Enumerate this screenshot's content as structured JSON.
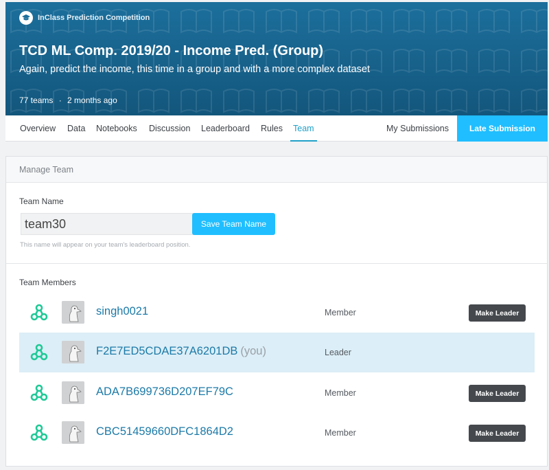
{
  "header": {
    "competition_type": "InClass Prediction Competition",
    "title": "TCD ML Comp. 2019/20 - Income Pred. (Group)",
    "subtitle": "Again, predict the income, this time in a group and with a more complex dataset",
    "teams": "77 teams",
    "separator": "·",
    "age": "2 months ago",
    "color": "#1c6f9c"
  },
  "tabs": [
    {
      "label": "Overview"
    },
    {
      "label": "Data"
    },
    {
      "label": "Notebooks"
    },
    {
      "label": "Discussion"
    },
    {
      "label": "Leaderboard"
    },
    {
      "label": "Rules"
    },
    {
      "label": "Team",
      "active": true
    },
    {
      "label": "My Submissions"
    }
  ],
  "late_submission_label": "Late Submission",
  "accent_color": "#20beff",
  "manage_team": {
    "heading": "Manage Team",
    "name_label": "Team Name",
    "name_value": "team30",
    "save_label": "Save Team Name",
    "hint": "This name will appear on your team's leaderboard position."
  },
  "members": {
    "heading": "Team Members",
    "make_leader_label": "Make Leader",
    "list": [
      {
        "name": "singh0021",
        "you": "",
        "role": "Member",
        "can_make_leader": true
      },
      {
        "name": "F2E7ED5CDAE37A6201DB",
        "you": "(you)",
        "role": "Leader",
        "can_make_leader": false
      },
      {
        "name": "ADA7B699736D207EF79C",
        "you": "",
        "role": "Member",
        "can_make_leader": true
      },
      {
        "name": "CBC51459660DFC1864D2",
        "you": "",
        "role": "Member",
        "can_make_leader": true
      }
    ]
  }
}
